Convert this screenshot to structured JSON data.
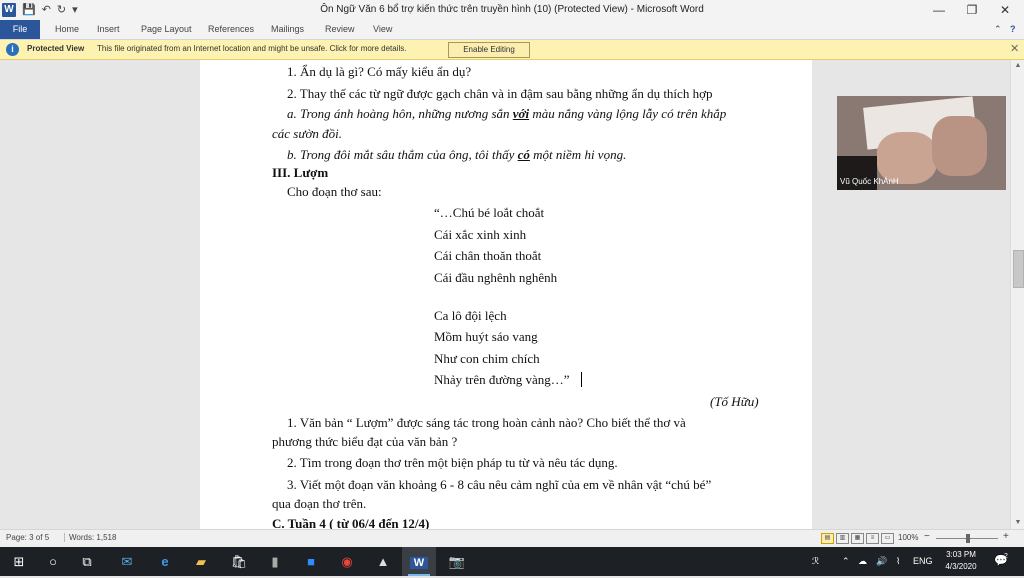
{
  "window": {
    "title": "Ôn Ngữ Văn 6 bổ trợ kiến thức trên truyền hình (10) (Protected View)  -  Microsoft Word",
    "app_icon_label": "W",
    "minimize": "—",
    "restore": "❐",
    "close": "✕"
  },
  "ribbon": {
    "tabs": [
      "File",
      "Home",
      "Insert",
      "Page Layout",
      "References",
      "Mailings",
      "Review",
      "View"
    ],
    "collapse_icon": "⌃",
    "help_icon": "?"
  },
  "protected_view": {
    "title": "Protected View",
    "message": "This file originated from an Internet location and might be unsafe. Click for more details.",
    "button": "Enable Editing"
  },
  "document": {
    "q1_cut": "1. Ẩn dụ là gì? Có mấy kiểu ẩn dụ?",
    "q2": "2. Thay thế các từ ngữ được gạch chân và in đậm sau bằng những ẩn dụ thích hợp",
    "a_pre": "a. Trong ánh hoàng hôn, những nương sắn ",
    "a_bold": "với",
    "a_post": " màu nắng vàng lộng lẫy có trên khắp",
    "a_line2": "các sườn đồi.",
    "b_pre": "b. Trong đôi mắt sâu thẳm của ông, tôi thấy ",
    "b_bold": "có",
    "b_post": " một niềm hi vọng.",
    "section": "III. Lượm",
    "intro": "Cho đoạn thơ sau:",
    "poem": [
      "“…Chú bé loắt choắt",
      "Cái xắc xinh xinh",
      "Cái chân thoăn thoắt",
      "Cái đầu nghênh nghênh",
      "Ca lô đội lệch",
      "Mồm huýt sáo vang",
      "Như con chim chích",
      "Nhảy trên đường vàng…”"
    ],
    "author": "(Tố Hữu)",
    "q1_a": "1. Văn bản “ Lượm” được sáng tác trong hoàn cảnh nào? Cho biết thể thơ và",
    "q1_b": "phương thức biểu đạt của văn bản ?",
    "q2b": "2. Tìm trong đoạn thơ trên một biện pháp tu từ và nêu tác dụng.",
    "q3_a": "3. Viết một đoạn văn khoảng 6 - 8 câu nêu cảm nghĩ của em về nhân vật “chú bé”",
    "q3_b": "qua đoạn thơ trên.",
    "section_c": "C. Tuần 4 ( từ 06/4 đến 12/4)"
  },
  "video_overlay": {
    "name": "Vũ Quốc KhÁnH"
  },
  "statusbar": {
    "page": "Page: 3 of 5",
    "words": "Words: 1,518",
    "zoom": "100%",
    "zoom_out": "−",
    "zoom_in": "+"
  },
  "taskbar": {
    "apps": [
      "start",
      "search",
      "task-view",
      "mail",
      "edge",
      "file-explorer",
      "store",
      "phone",
      "zoom",
      "chrome",
      "photos",
      "word",
      "camera"
    ],
    "tray_lang": "ENG",
    "time": "3:03 PM",
    "date": "4/3/2020",
    "notification_count": "2"
  }
}
